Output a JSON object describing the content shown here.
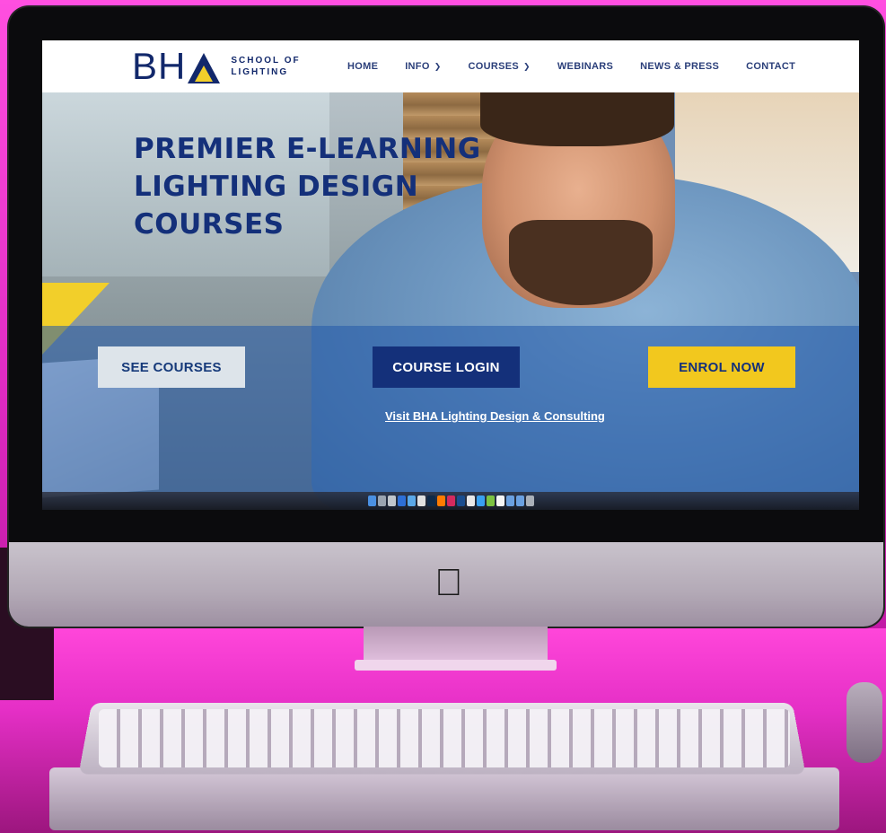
{
  "site": {
    "logo": {
      "mark": "BH",
      "tagline_line1": "SCHOOL OF",
      "tagline_line2": "LIGHTING"
    },
    "nav": [
      {
        "label": "HOME",
        "has_dropdown": false
      },
      {
        "label": "INFO",
        "has_dropdown": true
      },
      {
        "label": "COURSES",
        "has_dropdown": true
      },
      {
        "label": "WEBINARS",
        "has_dropdown": false
      },
      {
        "label": "NEWS & PRESS",
        "has_dropdown": false
      },
      {
        "label": "CONTACT",
        "has_dropdown": false
      }
    ],
    "hero": {
      "headline_line1": "PREMIER E-LEARNING",
      "headline_line2": "LIGHTING DESIGN",
      "headline_line3": "COURSES",
      "buttons": {
        "see_courses": "SEE COURSES",
        "course_login": "COURSE LOGIN",
        "enrol_now": "ENROL NOW"
      },
      "visit_link": "Visit BHA Lighting Design & Consulting"
    }
  },
  "icons": {
    "chevron": "chevron-down-icon",
    "apple": "apple-logo-icon"
  },
  "colors": {
    "brand_navy": "#14307a",
    "brand_yellow": "#f2c81e",
    "background_pink": "#e02cc3"
  }
}
